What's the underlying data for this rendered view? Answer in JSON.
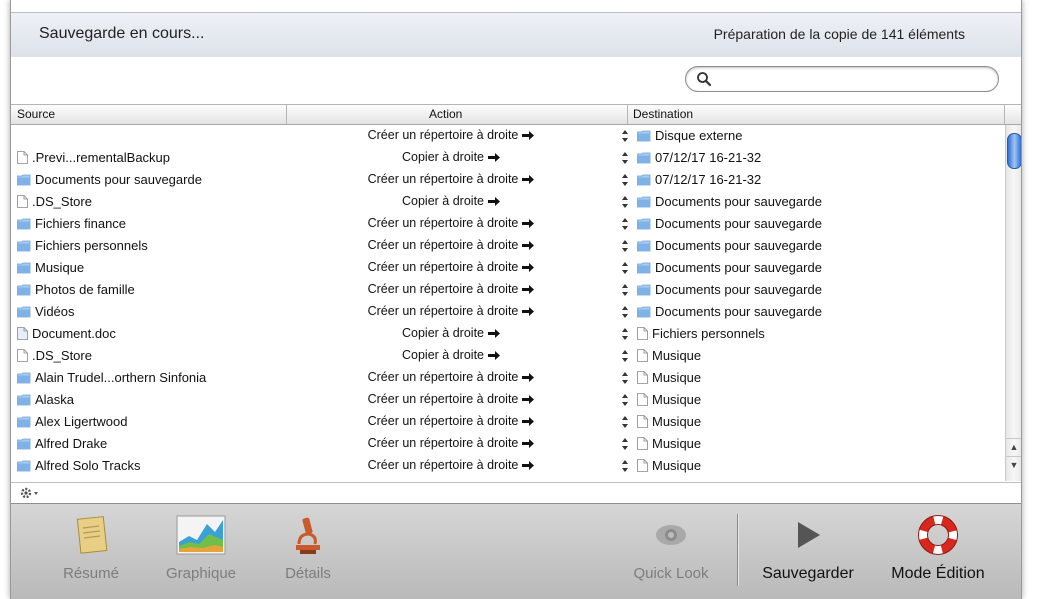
{
  "status": {
    "left_text": "Sauvegarde en cours...",
    "right_text": "Préparation de la copie de 141 éléments"
  },
  "search": {
    "placeholder": ""
  },
  "table": {
    "columns": [
      "Source",
      "Action",
      "Destination"
    ],
    "rows": [
      {
        "source": "",
        "source_icon": "none",
        "action": "Créer un répertoire à droite",
        "dest": "Disque externe",
        "dest_icon": "folder"
      },
      {
        "source": ".Previ...rementalBackup",
        "source_icon": "file",
        "action": "Copier à droite",
        "dest": "07/12/17 16-21-32",
        "dest_icon": "folder"
      },
      {
        "source": "Documents pour sauvegarde",
        "source_icon": "folder",
        "action": "Créer un répertoire à droite",
        "dest": "07/12/17 16-21-32",
        "dest_icon": "folder"
      },
      {
        "source": ".DS_Store",
        "source_icon": "file",
        "action": "Copier à droite",
        "dest": "Documents pour sauvegarde",
        "dest_icon": "folder"
      },
      {
        "source": "Fichiers finance",
        "source_icon": "folder",
        "action": "Créer un répertoire à droite",
        "dest": "Documents pour sauvegarde",
        "dest_icon": "folder"
      },
      {
        "source": "Fichiers personnels",
        "source_icon": "folder",
        "action": "Créer un répertoire à droite",
        "dest": "Documents pour sauvegarde",
        "dest_icon": "folder"
      },
      {
        "source": "Musique",
        "source_icon": "folder",
        "action": "Créer un répertoire à droite",
        "dest": "Documents pour sauvegarde",
        "dest_icon": "folder"
      },
      {
        "source": "Photos de famille",
        "source_icon": "folder",
        "action": "Créer un répertoire à droite",
        "dest": "Documents pour sauvegarde",
        "dest_icon": "folder"
      },
      {
        "source": "Vidéos",
        "source_icon": "folder",
        "action": "Créer un répertoire à droite",
        "dest": "Documents pour sauvegarde",
        "dest_icon": "folder"
      },
      {
        "source": "Document.doc",
        "source_icon": "doc",
        "action": "Copier à droite",
        "dest": "Fichiers personnels",
        "dest_icon": "file"
      },
      {
        "source": ".DS_Store",
        "source_icon": "file",
        "action": "Copier à droite",
        "dest": "Musique",
        "dest_icon": "file"
      },
      {
        "source": "Alain Trudel...orthern Sinfonia",
        "source_icon": "folder",
        "action": "Créer un répertoire à droite",
        "dest": "Musique",
        "dest_icon": "file"
      },
      {
        "source": "Alaska",
        "source_icon": "folder",
        "action": "Créer un répertoire à droite",
        "dest": "Musique",
        "dest_icon": "file"
      },
      {
        "source": "Alex Ligertwood",
        "source_icon": "folder",
        "action": "Créer un répertoire à droite",
        "dest": "Musique",
        "dest_icon": "file"
      },
      {
        "source": "Alfred Drake",
        "source_icon": "folder",
        "action": "Créer un répertoire à droite",
        "dest": "Musique",
        "dest_icon": "file"
      },
      {
        "source": "Alfred Solo Tracks",
        "source_icon": "folder",
        "action": "Créer un répertoire à droite",
        "dest": "Musique",
        "dest_icon": "file"
      }
    ]
  },
  "toolbar": {
    "summary_label": "Résumé",
    "graph_label": "Graphique",
    "details_label": "Détails",
    "quicklook_label": "Quick Look",
    "backup_label": "Sauvegarder",
    "edit_label": "Mode Édition"
  },
  "colors": {
    "folder": "#7fb3e8",
    "accent_blue": "#2f6fd1",
    "life_ring_red": "#d8271c"
  }
}
